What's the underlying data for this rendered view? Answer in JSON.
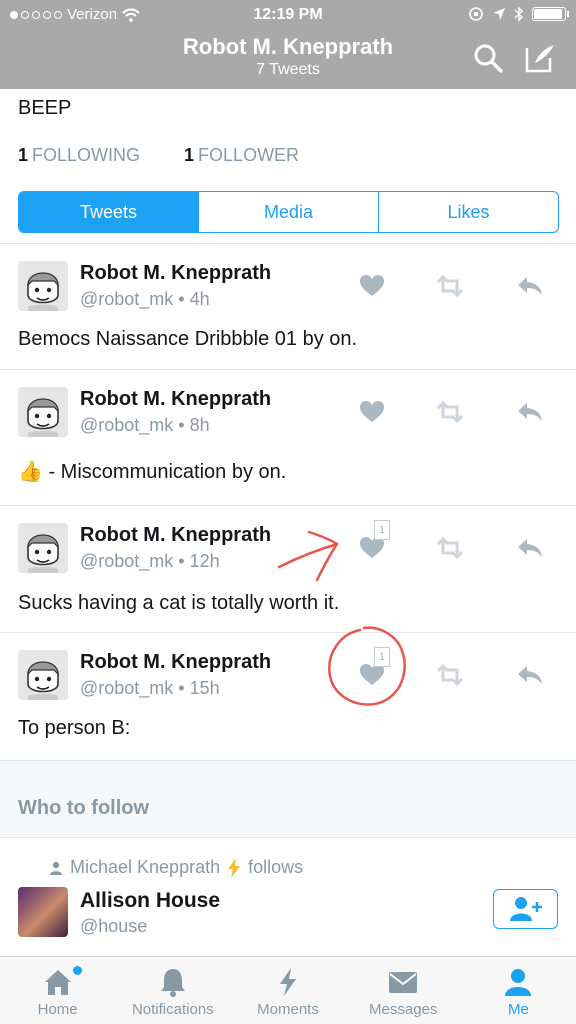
{
  "status_bar": {
    "carrier": "Verizon",
    "time": "12:19 PM",
    "signal_dots_filled": 1,
    "signal_dots_total": 5
  },
  "nav": {
    "title": "Robot M. Knepprath",
    "subtitle": "7 Tweets",
    "search_icon": "search-icon",
    "compose_icon": "compose-icon"
  },
  "profile": {
    "bio": "BEEP",
    "following_count": "1",
    "following_label": "FOLLOWING",
    "followers_count": "1",
    "followers_label": "FOLLOWER"
  },
  "tabs": [
    {
      "label": "Tweets",
      "active": true
    },
    {
      "label": "Media",
      "active": false
    },
    {
      "label": "Likes",
      "active": false
    }
  ],
  "tweets": [
    {
      "name": "Robot M. Knepprath",
      "meta": "@robot_mk • 4h",
      "text": "Bemocs Naissance Dribbble 01 by on.",
      "like_count": ""
    },
    {
      "name": "Robot M. Knepprath",
      "meta": "@robot_mk • 8h",
      "text": "👍 - Miscommunication by on.",
      "like_count": ""
    },
    {
      "name": "Robot M. Knepprath",
      "meta": "@robot_mk • 12h",
      "text": "Sucks having a cat is totally worth it.",
      "like_count": "1"
    },
    {
      "name": "Robot M. Knepprath",
      "meta": "@robot_mk • 15h",
      "text": "To person B:",
      "like_count": "1"
    }
  ],
  "who_to_follow": {
    "title": "Who to follow",
    "context_name": "Michael Knepprath",
    "context_suffix": "follows",
    "name": "Allison House",
    "handle": "@house"
  },
  "tabbar": [
    {
      "label": "Home",
      "active": false,
      "icon": "home-icon"
    },
    {
      "label": "Notifications",
      "active": false,
      "icon": "bell-icon"
    },
    {
      "label": "Moments",
      "active": false,
      "icon": "lightning-icon"
    },
    {
      "label": "Messages",
      "active": false,
      "icon": "envelope-icon"
    },
    {
      "label": "Me",
      "active": true,
      "icon": "person-icon"
    }
  ],
  "colors": {
    "accent": "#1da1f2",
    "nav_bg": "#a9a9a9",
    "muted": "#8899a6",
    "annotation": "#e8574d"
  }
}
